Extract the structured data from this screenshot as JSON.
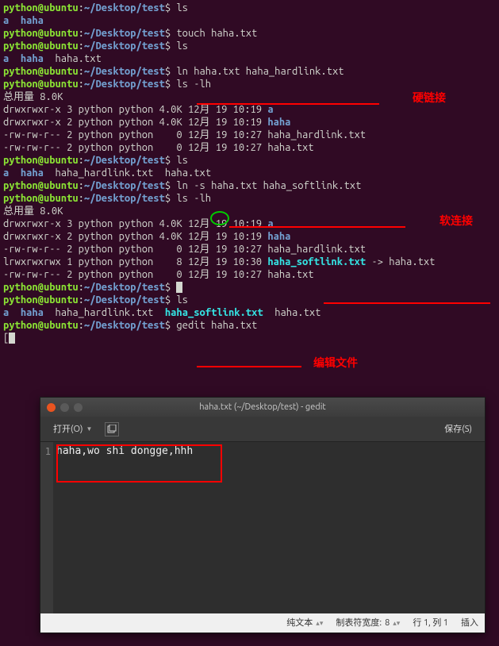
{
  "prompt": {
    "user_host": "python@ubuntu",
    "sep": ":",
    "path": "~/Desktop/test",
    "dollar": "$"
  },
  "lines": [
    {
      "type": "prompt",
      "cmd": "ls"
    },
    {
      "type": "ls1",
      "a": "a",
      "haha": "haha"
    },
    {
      "type": "prompt",
      "cmd": "touch haha.txt"
    },
    {
      "type": "prompt",
      "cmd": "ls"
    },
    {
      "type": "ls2",
      "a": "a",
      "haha": "haha",
      "hahatxt": "haha.txt"
    },
    {
      "type": "prompt",
      "cmd": "ln haha.txt haha_hardlink.txt"
    },
    {
      "type": "prompt",
      "cmd": "ls -lh"
    },
    {
      "type": "text",
      "val": "总用量 8.0K"
    },
    {
      "type": "ll",
      "perm": "drwxrwxr-x",
      "links": "3",
      "own": "python",
      "grp": "python",
      "size": "4.0K",
      "mon": "12月",
      "day": "19",
      "time": "10:19",
      "name": "a",
      "cls": "dir-blue"
    },
    {
      "type": "ll",
      "perm": "drwxrwxr-x",
      "links": "2",
      "own": "python",
      "grp": "python",
      "size": "4.0K",
      "mon": "12月",
      "day": "19",
      "time": "10:19",
      "name": "haha",
      "cls": "dir-blue"
    },
    {
      "type": "ll",
      "perm": "-rw-rw-r--",
      "links": "2",
      "own": "python",
      "grp": "python",
      "size": "   0",
      "mon": "12月",
      "day": "19",
      "time": "10:27",
      "name": "haha_hardlink.txt",
      "cls": "normal"
    },
    {
      "type": "ll",
      "perm": "-rw-rw-r--",
      "links": "2",
      "own": "python",
      "grp": "python",
      "size": "   0",
      "mon": "12月",
      "day": "19",
      "time": "10:27",
      "name": "haha.txt",
      "cls": "normal"
    },
    {
      "type": "prompt",
      "cmd": "ls"
    },
    {
      "type": "ls3",
      "a": "a",
      "haha": "haha",
      "hardlink": "haha_hardlink.txt",
      "hahatxt": "haha.txt"
    },
    {
      "type": "prompt",
      "cmd": "ln -s haha.txt haha_softlink.txt"
    },
    {
      "type": "prompt",
      "cmd": "ls -lh"
    },
    {
      "type": "text",
      "val": "总用量 8.0K"
    },
    {
      "type": "ll",
      "perm": "drwxrwxr-x",
      "links": "3",
      "own": "python",
      "grp": "python",
      "size": "4.0K",
      "mon": "12月",
      "day": "19",
      "time": "10:19",
      "name": "a",
      "cls": "dir-blue"
    },
    {
      "type": "ll",
      "perm": "drwxrwxr-x",
      "links": "2",
      "own": "python",
      "grp": "python",
      "size": "4.0K",
      "mon": "12月",
      "day": "19",
      "time": "10:19",
      "name": "haha",
      "cls": "dir-blue"
    },
    {
      "type": "ll",
      "perm": "-rw-rw-r--",
      "links": "2",
      "own": "python",
      "grp": "python",
      "size": "   0",
      "mon": "12月",
      "day": "19",
      "time": "10:27",
      "name": "haha_hardlink.txt",
      "cls": "normal"
    },
    {
      "type": "llsym",
      "perm": "lrwxrwxrwx",
      "links": "1",
      "own": "python",
      "grp": "python",
      "size": "   8",
      "mon": "12月",
      "day": "19",
      "time": "10:30",
      "name": "haha_softlink.txt",
      "arrow": " -> ",
      "target": "haha.txt"
    },
    {
      "type": "ll",
      "perm": "-rw-rw-r--",
      "links": "2",
      "own": "python",
      "grp": "python",
      "size": "   0",
      "mon": "12月",
      "day": "19",
      "time": "10:27",
      "name": "haha.txt",
      "cls": "normal"
    },
    {
      "type": "prompt",
      "cmd": "",
      "cursor": true
    },
    {
      "type": "prompt",
      "cmd": "ls"
    },
    {
      "type": "ls4",
      "a": "a",
      "haha": "haha",
      "hardlink": "haha_hardlink.txt",
      "softlink": "haha_softlink.txt",
      "hahatxt": "haha.txt"
    },
    {
      "type": "prompt",
      "cmd": "gedit haha.txt"
    },
    {
      "type": "emptycursor"
    }
  ],
  "annotations": {
    "hardlink_label": "硬链接",
    "softlink_label": "软连接",
    "edit_label": "编辑文件"
  },
  "gedit": {
    "title": "haha.txt (~/Desktop/test) - gedit",
    "open_btn": "打开(O)",
    "save_btn": "保存(S)",
    "line_number": "1",
    "content": "haha,wo shi  dongge,hhh",
    "status": {
      "lang": "纯文本",
      "tabwidth_label": "制表符宽度:",
      "tabwidth_value": "8",
      "position": "行 1, 列 1",
      "mode": "插入"
    }
  }
}
